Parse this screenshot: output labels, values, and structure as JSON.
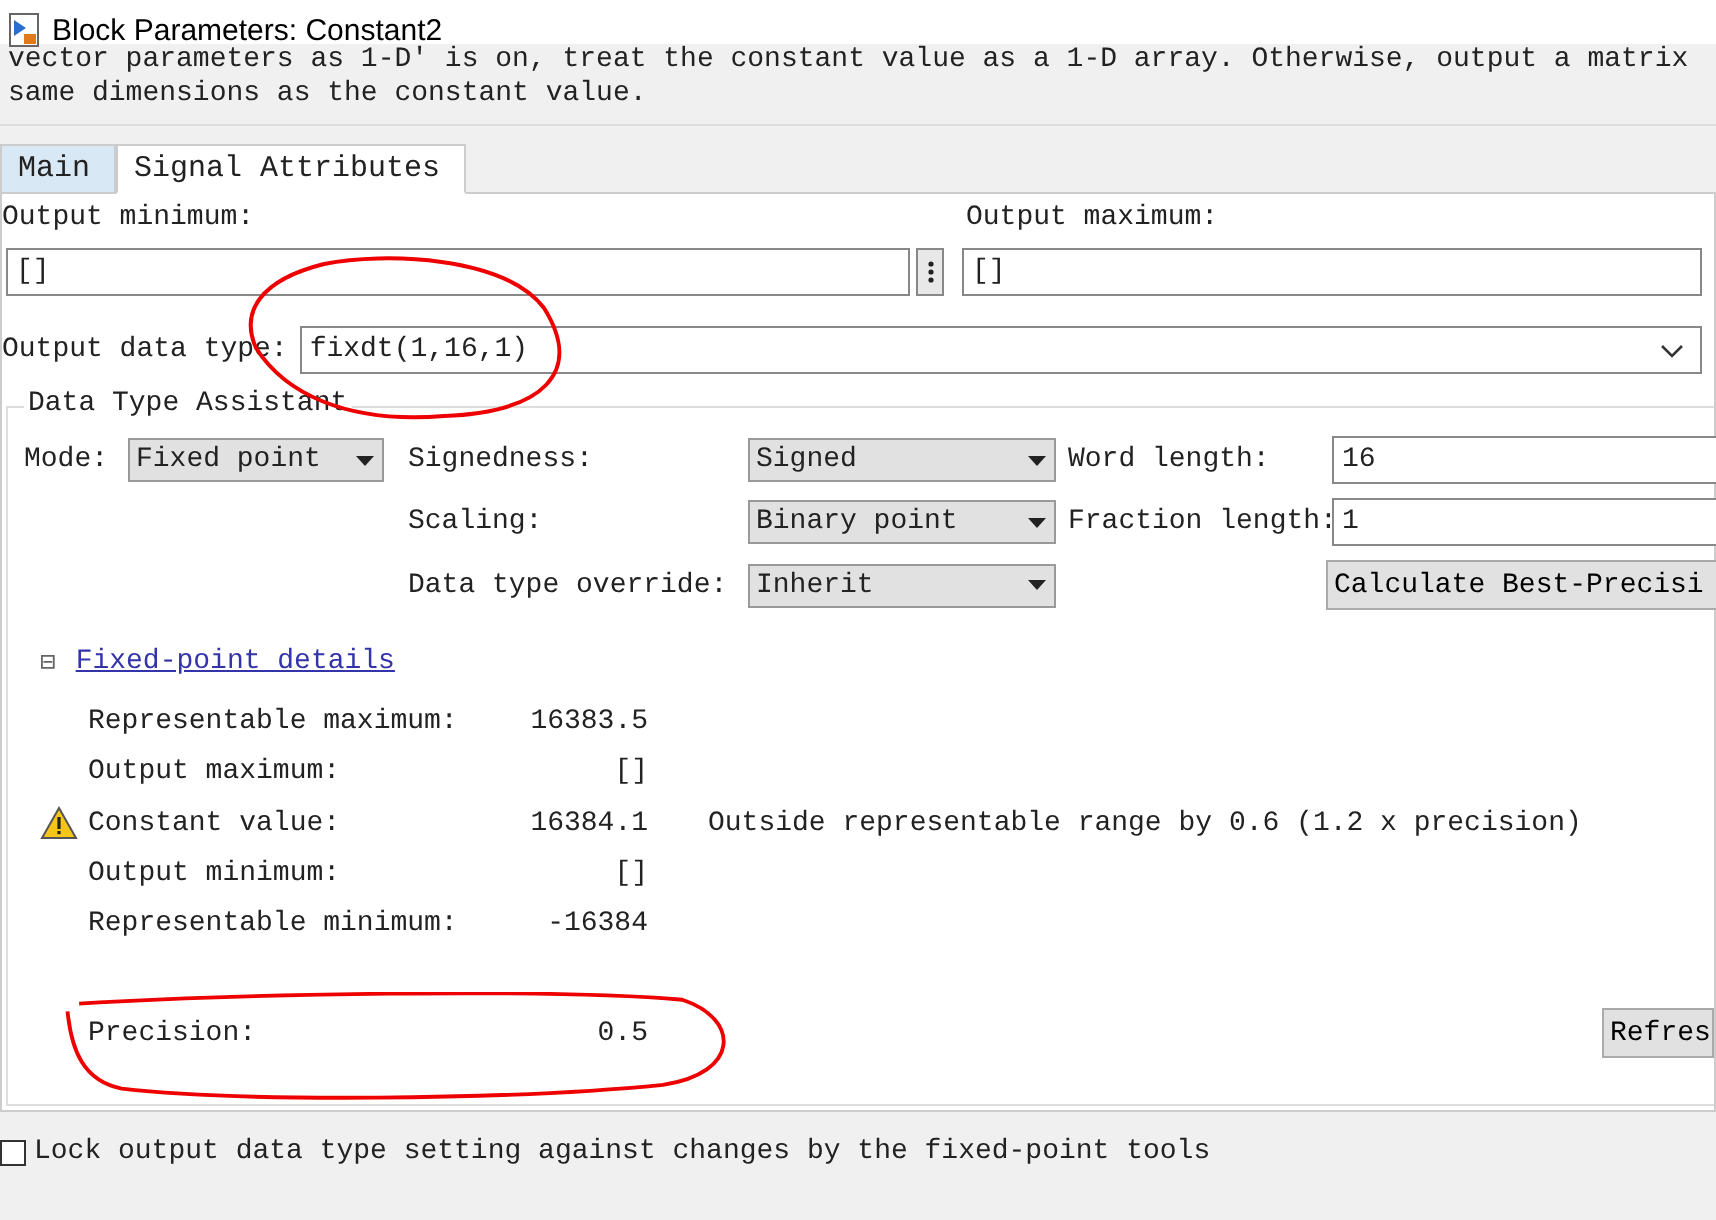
{
  "window": {
    "title": "Block Parameters: Constant2"
  },
  "description": [
    "vector parameters as 1-D' is on, treat the constant value as a 1-D array. Otherwise, output a matrix",
    "same dimensions as the constant value."
  ],
  "tabs": [
    {
      "label": "Main",
      "selected": false
    },
    {
      "label": "Signal Attributes",
      "selected": true
    }
  ],
  "output_minimum": {
    "label": "Output minimum:",
    "value": "[]"
  },
  "output_maximum": {
    "label": "Output maximum:",
    "value": "[]"
  },
  "output_data_type": {
    "label": "Output data type:",
    "value": "fixdt(1,16,1)"
  },
  "assistant": {
    "title": "Data Type Assistant",
    "mode": {
      "label": "Mode:",
      "value": "Fixed point"
    },
    "signedness": {
      "label": "Signedness:",
      "value": "Signed"
    },
    "scaling": {
      "label": "Scaling:",
      "value": "Binary point"
    },
    "override": {
      "label": "Data type override:",
      "value": "Inherit"
    },
    "word_length": {
      "label": "Word length:",
      "value": "16"
    },
    "fraction_length": {
      "label": "Fraction length:",
      "value": "1"
    },
    "calculate_button": "Calculate Best-Precisi",
    "details": {
      "expanded": true,
      "toggle": "⊟",
      "link": "Fixed-point details",
      "rows": [
        {
          "label": "Representable maximum:",
          "value": "16383.5",
          "warning": false
        },
        {
          "label": "Output maximum:",
          "value": "[]",
          "warning": false
        },
        {
          "label": "Constant value:",
          "value": "16384.1",
          "warning": true,
          "message": "Outside representable range by 0.6 (1.2 x precision)"
        },
        {
          "label": "Output minimum:",
          "value": "[]",
          "warning": false
        },
        {
          "label": "Representable minimum:",
          "value": "-16384",
          "warning": false
        }
      ],
      "precision": {
        "label": "Precision:",
        "value": "0.5"
      },
      "refresh_button": "Refres"
    }
  },
  "lock": {
    "label": "Lock output data type setting against changes by the fixed-point tools",
    "checked": false
  }
}
